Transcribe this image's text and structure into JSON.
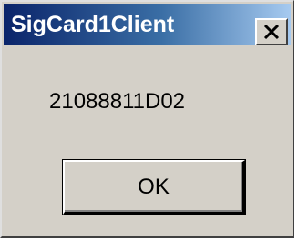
{
  "window": {
    "title": "SigCard1Client"
  },
  "title_bar": {
    "close_icon": "close-x-icon"
  },
  "dialog": {
    "message": "21088811D02",
    "ok_label": "OK"
  }
}
